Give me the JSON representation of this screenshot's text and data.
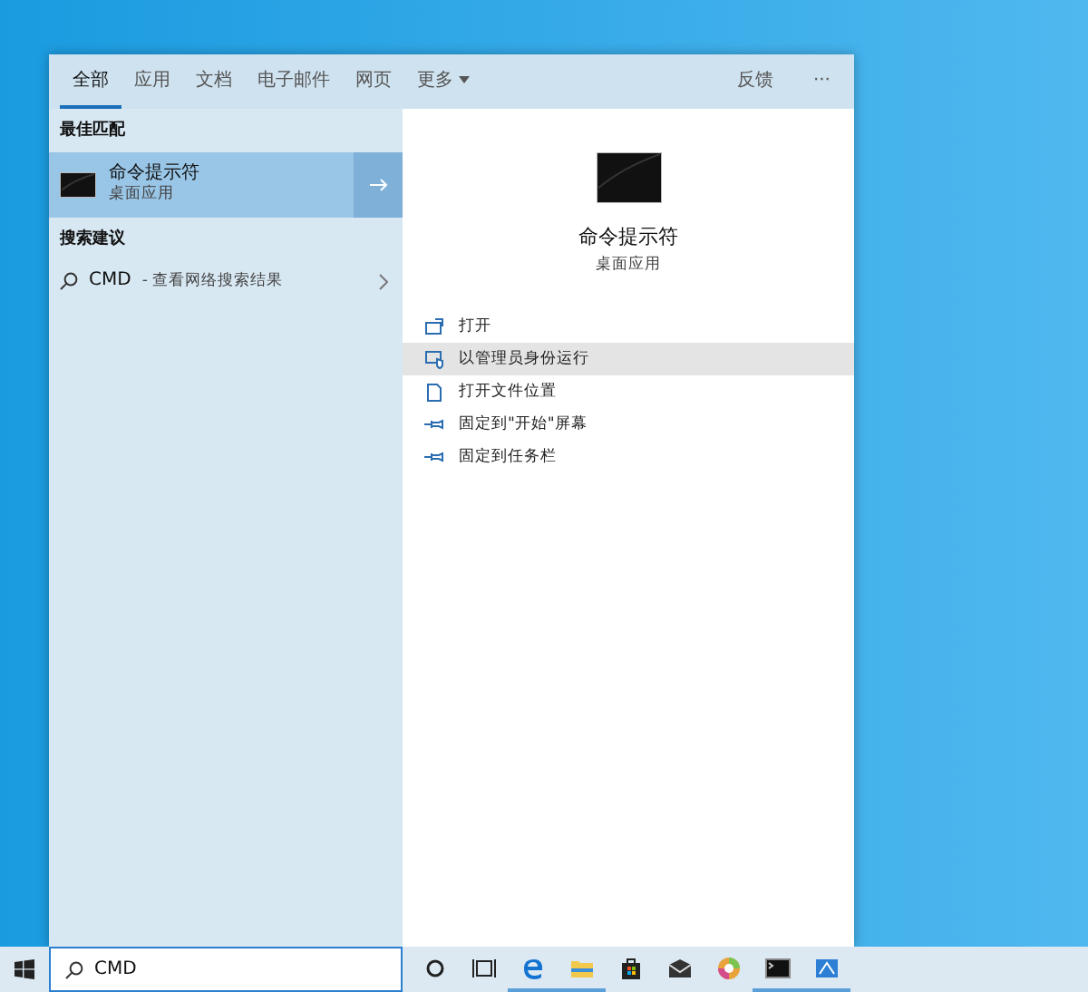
{
  "search_panel": {
    "tabs": [
      {
        "label": "全部",
        "selected": true
      },
      {
        "label": "应用",
        "selected": false
      },
      {
        "label": "文档",
        "selected": false
      },
      {
        "label": "电子邮件",
        "selected": false
      },
      {
        "label": "网页",
        "selected": false
      },
      {
        "label": "更多",
        "selected": false,
        "dropdown": true
      }
    ],
    "feedback": "反馈",
    "more": "···",
    "sections": [
      {
        "heading": "最佳匹配",
        "items": [
          {
            "kind": "app",
            "title": "命令提示符",
            "subtitle": "桌面应用",
            "selected": true
          }
        ]
      },
      {
        "heading": "搜索建议",
        "items": [
          {
            "kind": "web",
            "title": "CMD",
            "subtitle": "- 查看网络搜索结果",
            "selected": false
          }
        ]
      }
    ],
    "preview": {
      "title": "命令提示符",
      "subtitle": "桌面应用",
      "actions": [
        {
          "kind": "open",
          "label": "打开",
          "selected": false
        },
        {
          "kind": "admin",
          "label": "以管理员身份运行",
          "selected": true
        },
        {
          "kind": "folder",
          "label": "打开文件位置",
          "selected": false
        },
        {
          "kind": "pin",
          "label": "固定到\"开始\"屏幕",
          "selected": false
        },
        {
          "kind": "pin",
          "label": "固定到任务栏",
          "selected": false
        }
      ]
    }
  },
  "taskbar": {
    "search": {
      "value": "CMD"
    },
    "apps": [
      {
        "kind": "cortana",
        "running": false
      },
      {
        "kind": "taskview",
        "running": false
      },
      {
        "kind": "edge",
        "running": true
      },
      {
        "kind": "explorer",
        "running": true
      },
      {
        "kind": "store",
        "running": false
      },
      {
        "kind": "mail",
        "running": false
      },
      {
        "kind": "colorwheel",
        "running": false
      },
      {
        "kind": "terminal",
        "running": true
      },
      {
        "kind": "generic",
        "running": true
      }
    ]
  }
}
